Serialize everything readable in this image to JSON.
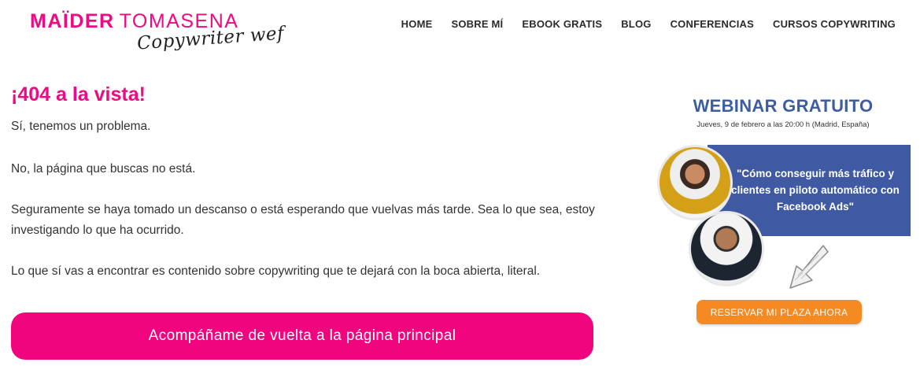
{
  "header": {
    "logo": {
      "first_name": "MAÏDER",
      "last_name": "TOMASENA",
      "tagline": "Copywriter wef"
    },
    "nav": [
      {
        "label": "HOME"
      },
      {
        "label": "SOBRE MÍ"
      },
      {
        "label": "EBOOK GRATIS"
      },
      {
        "label": "BLOG"
      },
      {
        "label": "CONFERENCIAS"
      },
      {
        "label": "CURSOS COPYWRITING"
      }
    ]
  },
  "main": {
    "title": "¡404 a la vista!",
    "paragraphs": [
      "Sí, tenemos un problema.",
      "No, la página que buscas no está.",
      "Seguramente se haya tomado un descanso o está esperando que vuelvas más tarde. Sea lo que sea, estoy investigando lo que ha ocurrido.",
      "Lo que sí vas a encontrar es contenido sobre copywriting que te dejará con la boca abierta, literal."
    ],
    "cta_label": "Acompáñame de vuelta a la página principal"
  },
  "sidebar": {
    "banner": {
      "title": "WEBINAR GRATUITO",
      "date": "Jueves, 9 de febrero a las 20:00 h (Madrid, España)",
      "quote": "\"Cómo conseguir más tráfico y clientes en piloto automático con Facebook Ads\"",
      "button_label": "RESERVAR MI PLAZA AHORA"
    }
  },
  "colors": {
    "brand_pink": "#ec0b83",
    "cta_pink": "#f0057e",
    "banner_blue": "#3f5aa3",
    "title_blue": "#3c5da0",
    "reserve_orange": "#f58a22"
  },
  "icons": {
    "arrow": "arrow-down-left-icon"
  }
}
